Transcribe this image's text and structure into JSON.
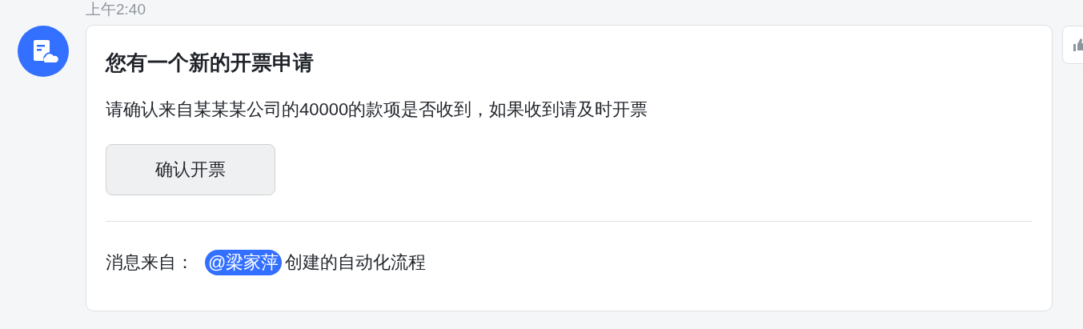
{
  "message": {
    "time": "上午2:40",
    "card": {
      "title": "您有一个新的开票申请",
      "body": "请确认来自某某某公司的40000的款项是否收到，如果收到请及时开票",
      "action_button": "确认开票",
      "footer": {
        "label": "消息来自：",
        "mention": "@梁家萍",
        "suffix": "创建的自动化流程"
      }
    }
  }
}
